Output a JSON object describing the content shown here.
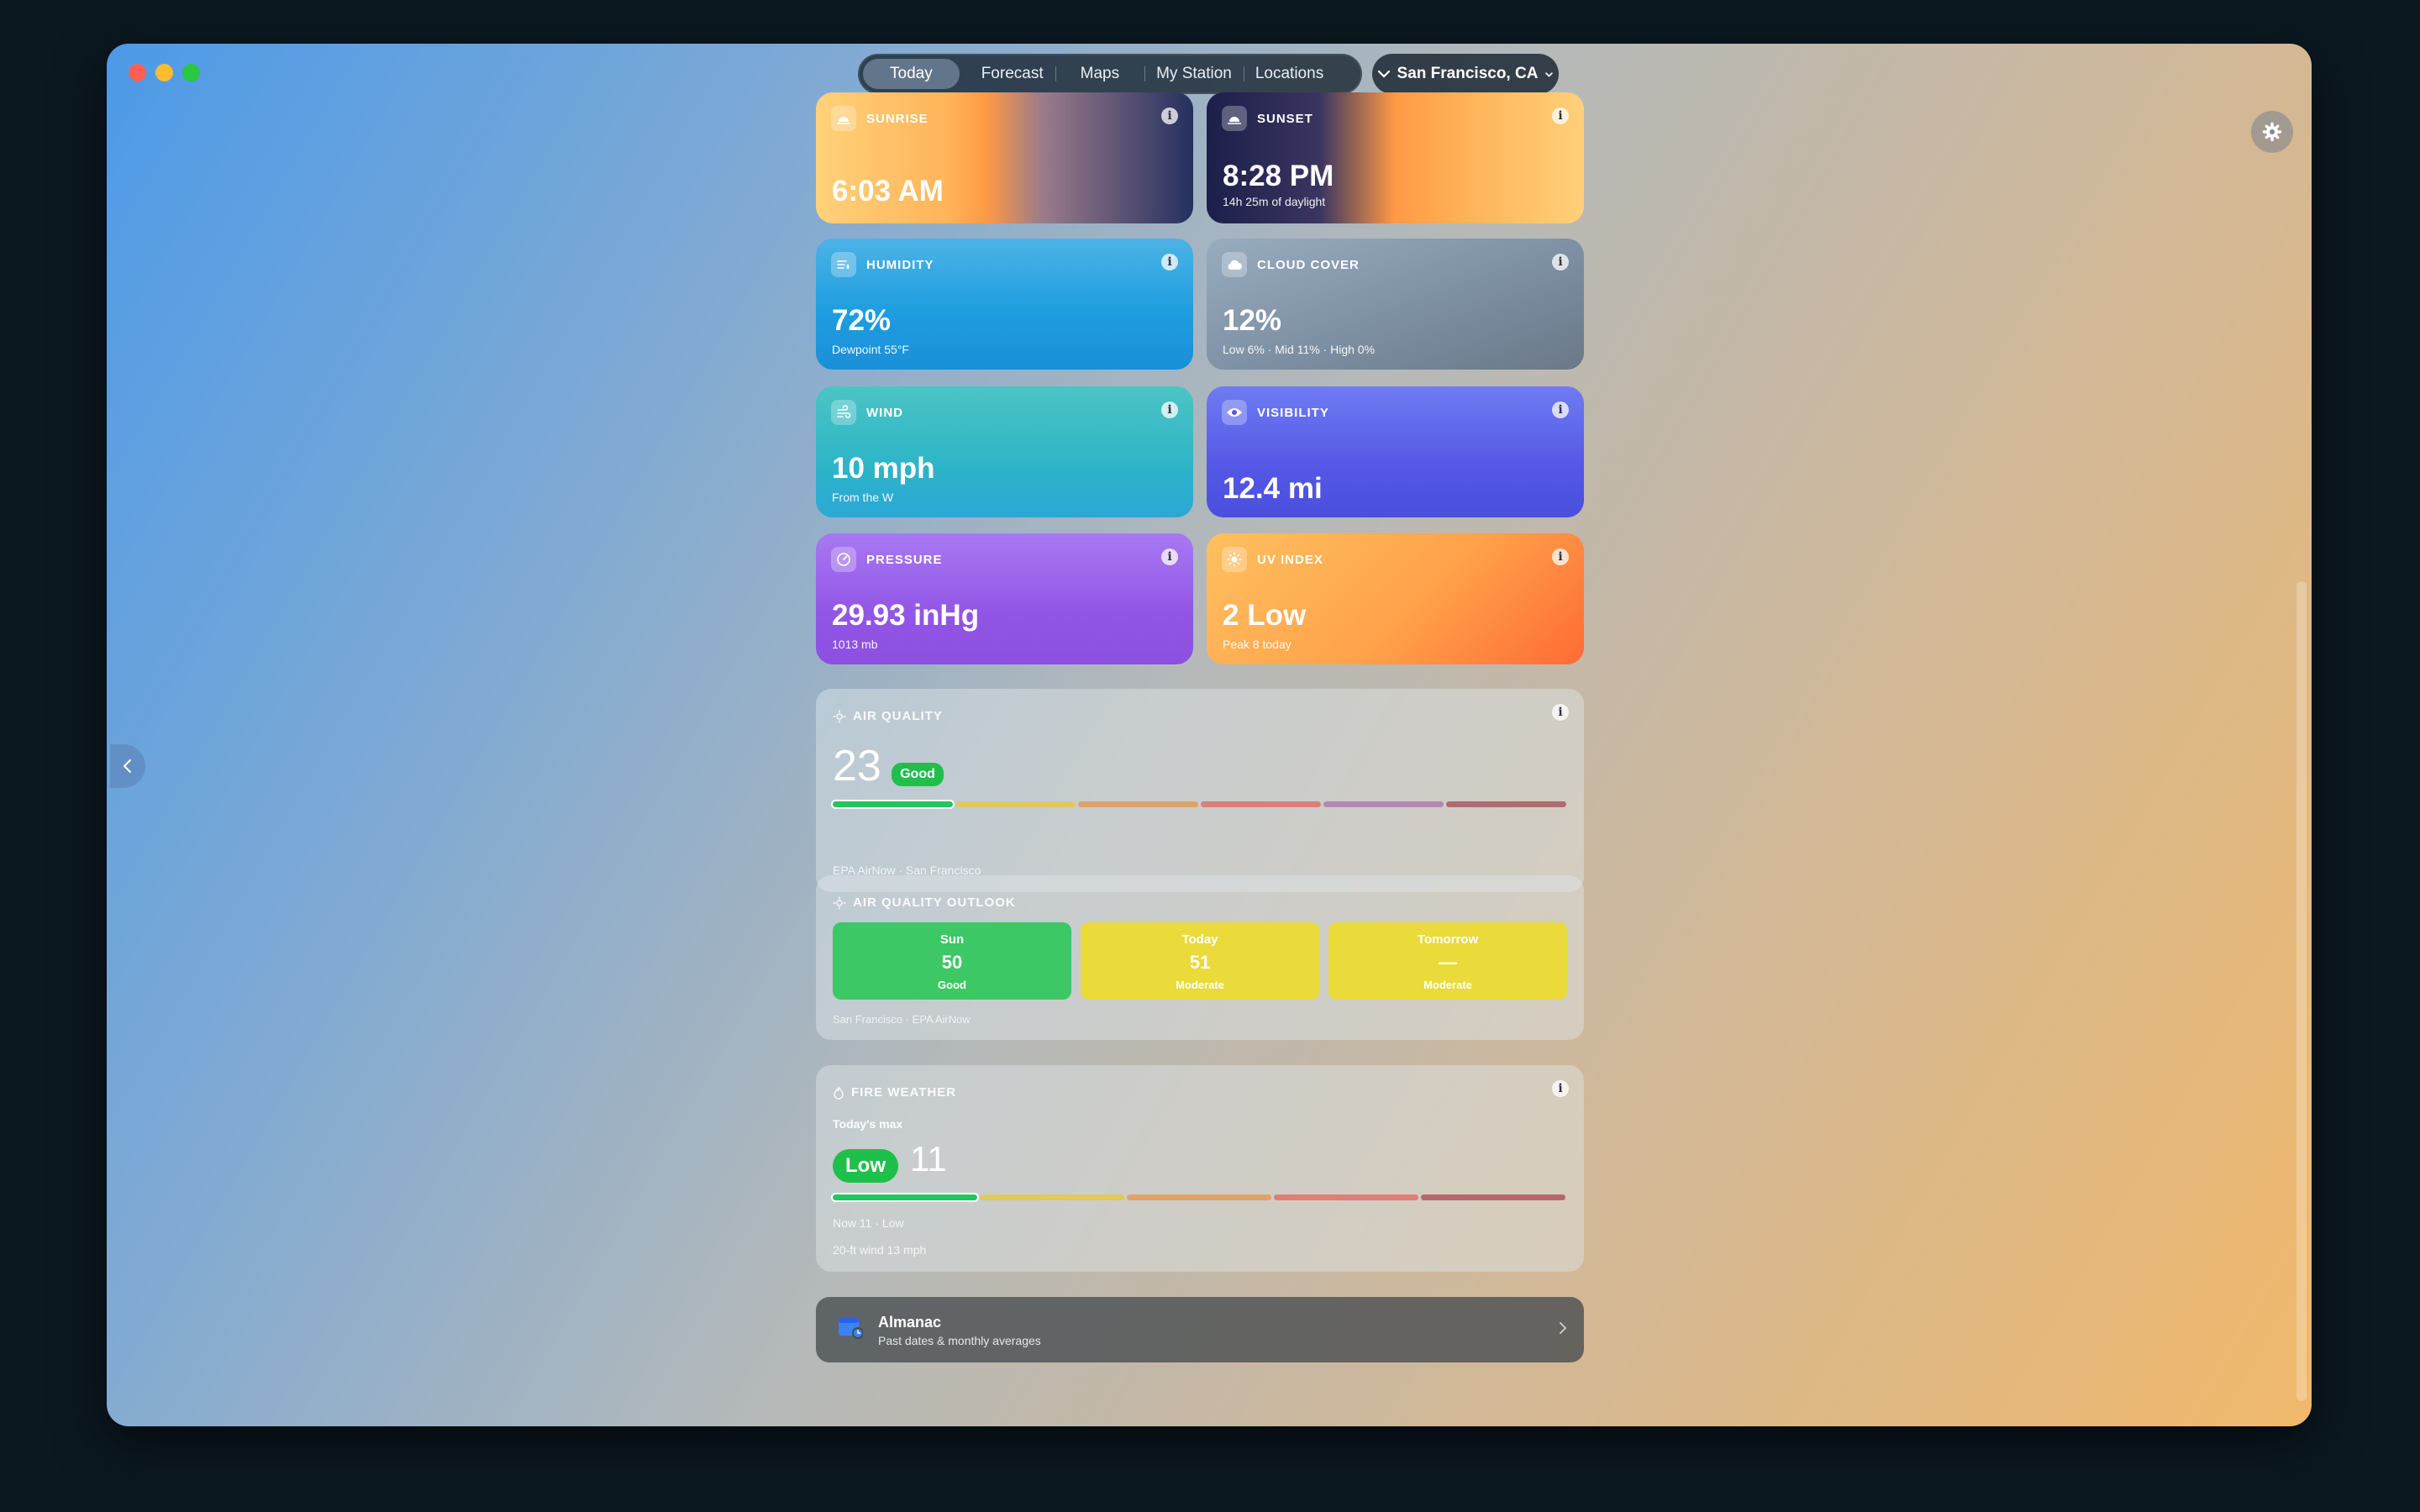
{
  "nav": {
    "tabs": [
      {
        "label": "Today"
      },
      {
        "label": "Forecast"
      },
      {
        "label": "Maps"
      },
      {
        "label": "My Station"
      },
      {
        "label": "Locations"
      }
    ],
    "location": "San Francisco, CA"
  },
  "tiles": {
    "sunrise": {
      "title": "SUNRISE",
      "value": "6:03 AM",
      "icon": "sunrise-icon"
    },
    "sunset": {
      "title": "SUNSET",
      "value": "8:28 PM",
      "sub": "14h 25m of daylight",
      "icon": "sunset-icon"
    },
    "humidity": {
      "title": "HUMIDITY",
      "value": "72%",
      "sub": "Dewpoint 55°F",
      "icon": "humidity-icon"
    },
    "cloud": {
      "title": "CLOUD COVER",
      "value": "12%",
      "sub": "Low 6% · Mid 11% · High 0%",
      "icon": "cloud-icon"
    },
    "wind": {
      "title": "WIND",
      "value": "10 mph",
      "sub": "From the W",
      "icon": "wind-icon"
    },
    "visibility": {
      "title": "VISIBILITY",
      "value": "12.4 mi",
      "icon": "eye-icon"
    },
    "pressure": {
      "title": "PRESSURE",
      "value": "29.93 inHg",
      "sub": "1013 mb",
      "icon": "gauge-icon"
    },
    "uv": {
      "title": "UV INDEX",
      "value": "2 Low",
      "sub": "Peak 8 today",
      "icon": "sun-icon"
    }
  },
  "air_quality": {
    "title": "AIR QUALITY",
    "value": "23",
    "badge": "Good",
    "source": "EPA AirNow · San Francisco",
    "scale_colors": [
      "#22c55e",
      "#e3c84a",
      "#e59a55",
      "#e0706a",
      "#b07ab0",
      "#a85a60"
    ]
  },
  "aq_outlook": {
    "title": "AIR QUALITY OUTLOOK",
    "days": [
      {
        "label": "Sun",
        "value": "50",
        "category": "Good",
        "color": "#3cc864"
      },
      {
        "label": "Today",
        "value": "51",
        "category": "Moderate",
        "color": "#eada3a"
      },
      {
        "label": "Tomorrow",
        "value": "—",
        "category": "Moderate",
        "color": "#eada3a"
      }
    ],
    "source": "San Francisco · EPA AirNow"
  },
  "fire": {
    "title": "FIRE WEATHER",
    "max_label": "Today's max",
    "badge": "Low",
    "value": "11",
    "now": "Now 11 · Low",
    "wind": "20-ft wind 13 mph",
    "scale_colors": [
      "#22c55e",
      "#e3c84a",
      "#e59a55",
      "#e0706a",
      "#b05560"
    ]
  },
  "almanac": {
    "title": "Almanac",
    "subtitle": "Past dates & monthly averages"
  }
}
